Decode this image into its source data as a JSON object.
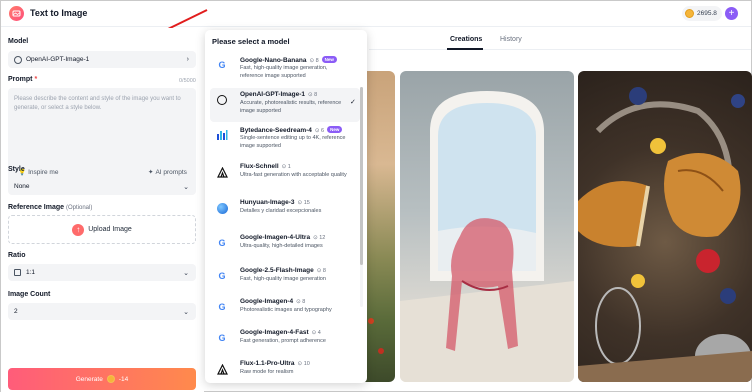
{
  "header": {
    "title": "Text to Image",
    "credits": "2695.8",
    "plus_label": "+"
  },
  "left_panel": {
    "model_label": "Model",
    "model_value": "OpenAI-GPT-Image-1",
    "prompt_label": "Prompt",
    "prompt_required": "*",
    "prompt_counter": "0/5000",
    "prompt_placeholder": "Please describe the content and style of the image you want to generate, or select a style below.",
    "inspire_label": "Inspire me",
    "ai_prompts_label": "AI prompts",
    "style_label": "Style",
    "style_value": "None",
    "reference_label": "Reference Image",
    "reference_optional": "(Optional)",
    "upload_label": "Upload Image",
    "ratio_label": "Ratio",
    "ratio_value": "1:1",
    "count_label": "Image Count",
    "count_value": "2",
    "generate_label": "Generate",
    "generate_cost": "-14"
  },
  "dropdown": {
    "title": "Please select a model",
    "items": [
      {
        "name": "Google-Nano-Banana",
        "count": "8",
        "badge": "New",
        "desc": "Fast, high-quality image generation, reference image supported",
        "icon": "google-icon",
        "selected": false
      },
      {
        "name": "OpenAI-GPT-Image-1",
        "count": "8",
        "badge": "",
        "desc": "Accurate, photorealistic results, reference image supported",
        "icon": "openai-icon",
        "selected": true
      },
      {
        "name": "Bytedance-Seedream-4",
        "count": "6",
        "badge": "New",
        "desc": "Single-sentence editing up to 4K, reference image supported",
        "icon": "bytedance-icon",
        "selected": false
      },
      {
        "name": "Flux-Schnell",
        "count": "1",
        "badge": "",
        "desc": "Ultra-fast generation with acceptable quality",
        "icon": "flux-icon",
        "selected": false
      },
      {
        "name": "Hunyuan-Image-3",
        "count": "15",
        "badge": "",
        "desc": "Detalles y claridad excepcionales",
        "icon": "hunyuan-icon",
        "selected": false
      },
      {
        "name": "Google-Imagen-4-Ultra",
        "count": "12",
        "badge": "",
        "desc": "Ultra-quality, high-detailed images",
        "icon": "google-icon",
        "selected": false
      },
      {
        "name": "Google-2.5-Flash-Image",
        "count": "8",
        "badge": "",
        "desc": "Fast, high-quality image generation",
        "icon": "google-icon",
        "selected": false
      },
      {
        "name": "Google-Imagen-4",
        "count": "8",
        "badge": "",
        "desc": "Photorealistic images and typography",
        "icon": "google-icon",
        "selected": false
      },
      {
        "name": "Google-Imagen-4-Fast",
        "count": "4",
        "badge": "",
        "desc": "Fast generation, prompt adherence",
        "icon": "google-icon",
        "selected": false
      },
      {
        "name": "Flux-1.1-Pro-Ultra",
        "count": "10",
        "badge": "",
        "desc": "Raw mode for realism",
        "icon": "flux-icon",
        "selected": false
      }
    ]
  },
  "tabs": {
    "creations": "Creations",
    "history": "History"
  },
  "colors": {
    "accent": "#8b5cf6",
    "generate_start": "#ff5c7a",
    "generate_end": "#ff8a4c",
    "annotation_arrow": "#e11d1d"
  }
}
